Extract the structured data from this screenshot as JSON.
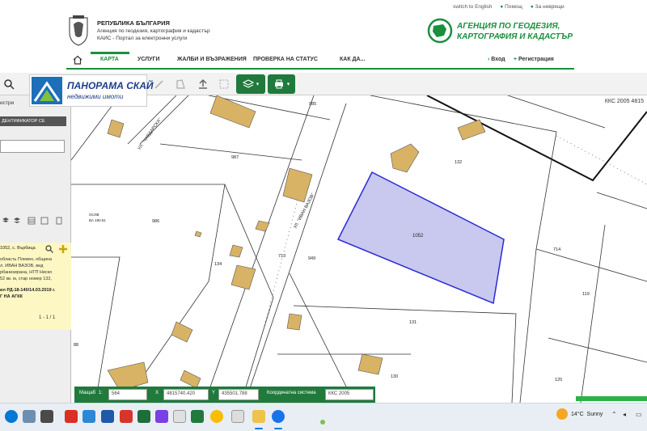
{
  "header": {
    "org_title": "РЕПУБЛИКА БЪЛГАРИЯ",
    "org_sub1": "Агенция по геодезия, картография и кадастър",
    "org_sub2": "КАИС - Портал за електронни услуги",
    "toplinks": [
      "switch to English",
      "Помощ",
      "За неврящи"
    ],
    "agency_line1": "АГЕНЦИЯ ПО ГЕОДЕЗИЯ,",
    "agency_line2": "КАРТОГРАФИЯ И КАДАСТЪР"
  },
  "nav": {
    "items": [
      "КАРТА",
      "УСЛУГИ",
      "ЖАЛБИ И ВЪЗРАЖЕНИЯ",
      "ПРОВЕРКА НА СТАТУС",
      "КАК ДА..."
    ],
    "login": "Вход",
    "register": "Регистрация"
  },
  "overlay_logo": {
    "title": "ПАНОРАМА СКАЙ",
    "subtitle": "недвижими имоти"
  },
  "left_panel": {
    "tab": "истри",
    "header": "ДЕНТИФИКАТОР СЕ",
    "result_title": "1052, с. Върбица",
    "result_lines": [
      "область Плевен, община",
      "л. ИВАН ВАЗОВ, вид",
      "рбанизирана, НТП Ниско",
      "52 кв. м, стар номер 132,"
    ],
    "result_bold": [
      "ил РД-18-140/14.03.2019 г.",
      "Г НА АГКК"
    ],
    "pagination": "1 - 1 / 1"
  },
  "map": {
    "kks_label": "ККС 2005 4815",
    "selected_parcel": "1052",
    "street_labels": [
      "УЛ. \"ЧАВДАРСКА\"",
      "УЛ. \"ИВАН ВАЗОВ\""
    ],
    "parcel_labels": [
      "985",
      "987",
      "132",
      "986",
      "134",
      "713",
      "949",
      "714",
      "119",
      "131",
      "130",
      "120",
      "88"
    ],
    "small_labels": [
      "ОСЛВ",
      "ВА 190.51"
    ]
  },
  "coord_bar": {
    "scale_label": "Мащаб",
    "scale_prefix": "1:",
    "scale_value": "564",
    "x_label": "X",
    "x_value": "4815740.420",
    "y_label": "Y",
    "y_value": "435501.788",
    "system_label": "Координатна система",
    "system_value": "ККС 2005"
  },
  "taskbar": {
    "temperature": "14°C",
    "weather": "Sunny"
  },
  "colors": {
    "brand_green": "#1a8f3e",
    "toolbar_green": "#1f7a3c",
    "parcel_fill": "#c9c8ee",
    "parcel_stroke": "#2a2ad6",
    "building_fill": "#d8b365",
    "result_bg": "#fdf7c3"
  }
}
